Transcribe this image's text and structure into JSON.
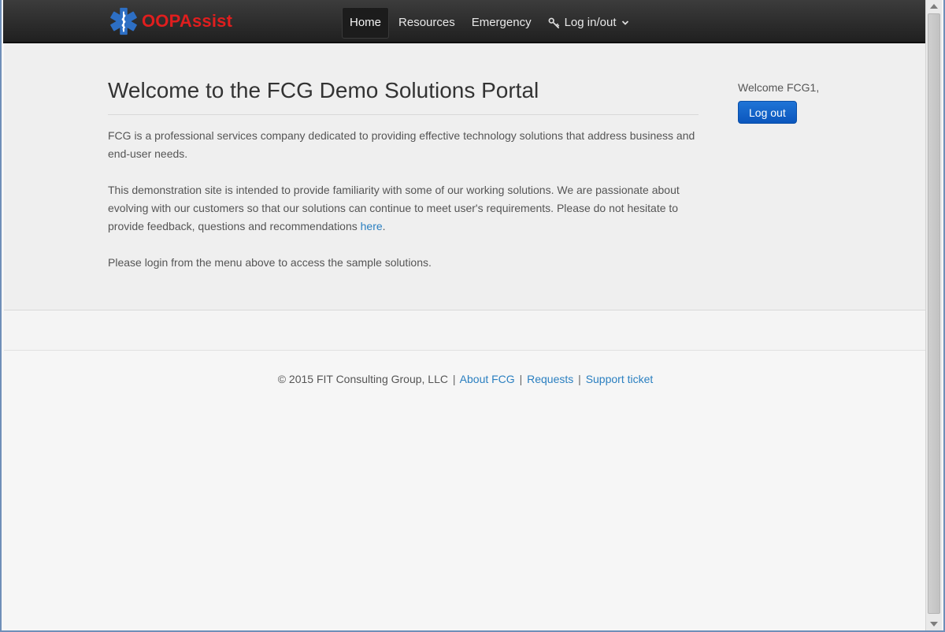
{
  "brand": {
    "name": "OOPAssist",
    "icon": "star-of-life-icon"
  },
  "nav": {
    "home": "Home",
    "resources": "Resources",
    "emergency": "Emergency",
    "login": "Log in/out",
    "login_icon": "key-icon",
    "dropdown_icon": "chevron-down-icon"
  },
  "main": {
    "title": "Welcome to the FCG Demo Solutions Portal",
    "para1": "FCG is a professional services company dedicated to providing effective technology solutions that address business and end-user needs.",
    "para2_text": "This demonstration site is intended to provide familiarity with some of our working solutions. We are passionate about evolving with our customers so that our solutions can continue to meet user's requirements.  Please do not hesitate to provide feedback, questions and recommendations ",
    "para2_link": "here",
    "para2_end": ".",
    "para3": "Please login from the menu above to access the sample solutions."
  },
  "sidebar": {
    "welcome": "Welcome FCG1,",
    "logout": "Log out"
  },
  "footer": {
    "copyright": "© 2015 FIT Consulting Group, LLC",
    "separator": "|",
    "about": "About FCG",
    "requests": "Requests",
    "support": "Support ticket"
  },
  "colors": {
    "brand_red": "#e01e1e",
    "link_blue": "#2a7fc0",
    "button_blue": "#0b56bd",
    "navbar_dark": "#2a2a2a"
  }
}
